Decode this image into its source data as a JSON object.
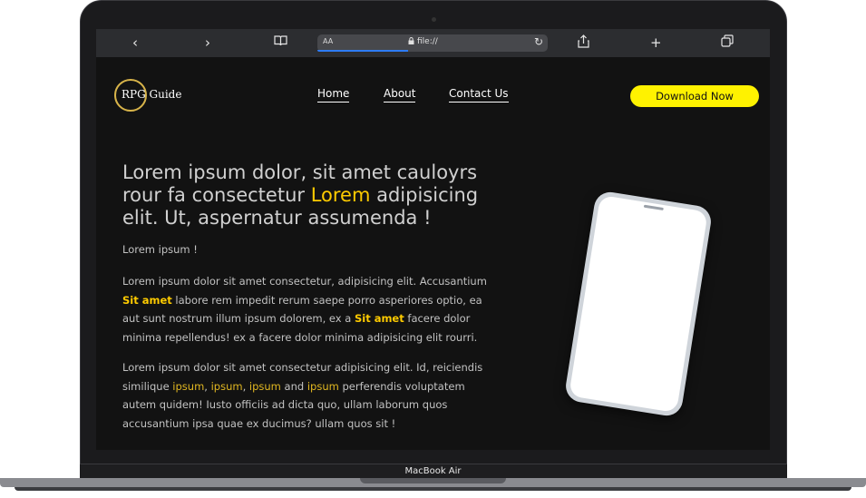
{
  "device": {
    "label": "MacBook Air"
  },
  "browser": {
    "back_icon": "chevron-left-icon",
    "forward_icon": "chevron-right-icon",
    "reader_icon": "book-icon",
    "text_size": "AA",
    "url": "file://",
    "lock_icon": "lock-icon",
    "reload_icon": "reload-icon",
    "share_icon": "share-icon",
    "new_tab_icon": "plus-icon",
    "tabs_icon": "tabs-icon"
  },
  "site": {
    "logo_text": "RPG Guide",
    "nav": [
      {
        "label": "Home"
      },
      {
        "label": "About"
      },
      {
        "label": "Contact Us"
      }
    ],
    "cta": "Download Now",
    "colors": {
      "accent": "#fff200",
      "highlight": "#fecb00",
      "background": "#121212"
    }
  },
  "hero": {
    "heading_part1": "Lorem ipsum dolor, sit amet cauloyrs rour fa consectetur ",
    "heading_highlight": "Lorem",
    "heading_part2": " adipisicing elit. Ut, aspernatur assumenda !",
    "subtitle": "Lorem ipsum !",
    "p1_part1": "Lorem ipsum dolor sit amet consectetur, adipisicing elit. Accusantium ",
    "p1_hl1": "Sit amet",
    "p1_part2": " labore rem impedit rerum saepe porro asperiores optio, ea aut sunt nostrum illum ipsum dolorem, ex a ",
    "p1_hl2": "Sit amet",
    "p1_part3": " facere dolor minima repellendus! ex a facere dolor minima adipisicing elit rourri.",
    "p2_part1": "Lorem ipsum dolor sit amet consectetur adipisicing elit. Id, reiciendis similique ",
    "p2_hl1": "ipsum",
    "p2_sep1": ", ",
    "p2_hl2": "ipsum",
    "p2_sep2": ", ",
    "p2_hl3": "ipsum",
    "p2_and": " and ",
    "p2_hl4": "ipsum",
    "p2_part2": " perferendis voluptatem autem quidem! Iusto officiis ad dicta quo, ullam laborum quos accusantium ipsa quae ex ducimus? ullam quos sit !"
  }
}
